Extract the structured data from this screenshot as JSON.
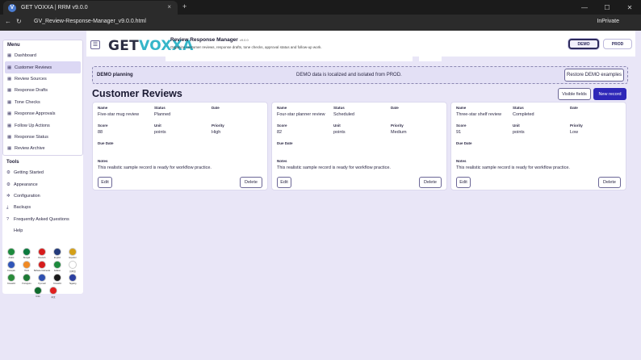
{
  "browser": {
    "tab_title": "GET VOXXA | RRM v9.0.0",
    "url": "GV_Review-Response-Manager_v9.0.0.html",
    "inprivate": "InPrivate",
    "tab_close": "×",
    "new_tab": "+",
    "win_min": "—",
    "win_max": "☐",
    "win_close": "✕",
    "nav_back": "←",
    "nav_refresh": "↻"
  },
  "header": {
    "logo_part1": "GET",
    "logo_part2": "VOXXA",
    "app_title": "Review Response Manager",
    "app_version": "v9.0.0",
    "app_subtitle": "Organize customer reviews, response drafts, tone checks, approval status and follow-up work.",
    "demo_label": "DEMO",
    "prod_label": "PROD",
    "menu_icon": "☰"
  },
  "sidebar": {
    "menu_heading": "Menu",
    "menu_items": [
      {
        "label": "Dashboard",
        "icon": "▦"
      },
      {
        "label": "Customer Reviews",
        "icon": "▦",
        "active": true
      },
      {
        "label": "Review Sources",
        "icon": "▦"
      },
      {
        "label": "Response Drafts",
        "icon": "▦"
      },
      {
        "label": "Tone Checks",
        "icon": "▦"
      },
      {
        "label": "Response Approvals",
        "icon": "▦"
      },
      {
        "label": "Follow Up Actions",
        "icon": "▦"
      },
      {
        "label": "Response Status",
        "icon": "▦"
      },
      {
        "label": "Review Archive",
        "icon": "▦"
      }
    ],
    "tools_heading": "Tools",
    "tools_items": [
      {
        "label": "Getting Started",
        "icon": "⚙"
      },
      {
        "label": "Appearance",
        "icon": "⚙"
      },
      {
        "label": "Configuration",
        "icon": "✲"
      },
      {
        "label": "Backups",
        "icon": "⤓"
      },
      {
        "label": "Frequently Asked Questions",
        "icon": "?"
      },
      {
        "label": "Help",
        "icon": ""
      }
    ],
    "flags": [
      [
        {
          "label": "Arabic",
          "color": "#1d8a3d"
        },
        {
          "label": "Bengali",
          "color": "#0b7a3e"
        },
        {
          "label": "Deutsch",
          "color": "#d61c1c"
        },
        {
          "label": "English",
          "color": "#243b7a"
        },
        {
          "label": "Español",
          "color": "#d4a017"
        }
      ],
      [
        {
          "label": "Français",
          "color": "#3055b8"
        },
        {
          "label": "Hindi",
          "color": "#f08a24"
        },
        {
          "label": "Bahasa Indonesia",
          "color": "#d61c1c"
        },
        {
          "label": "Italiano",
          "color": "#1d8a3d"
        },
        {
          "label": "日本語",
          "color": "#ffffff"
        }
      ],
      [
        {
          "label": "Kiswahili",
          "color": "#2a8b3a"
        },
        {
          "label": "Português",
          "color": "#1d7a34"
        },
        {
          "label": "Русский",
          "color": "#2f50b0"
        },
        {
          "label": "Kiswahili",
          "color": "#1a1a1a"
        },
        {
          "label": "Tagalog",
          "color": "#2b3fa0"
        }
      ],
      [
        {
          "label": "Urdu",
          "color": "#0f6b2d"
        },
        {
          "label": "中文",
          "color": "#e02020"
        }
      ]
    ]
  },
  "banner": {
    "label": "DEMO planning",
    "message": "DEMO data is localized and isolated from PROD.",
    "restore_label": "Restore DEMO examples"
  },
  "section": {
    "title": "Customer Reviews",
    "visible_fields_label": "Visible fields",
    "new_record_label": "New record"
  },
  "field_labels": {
    "name": "Name",
    "status": "Status",
    "date": "Date",
    "score": "Score",
    "unit": "Unit",
    "priority": "Priority",
    "due_date": "Due Date",
    "notes": "Notes"
  },
  "cards": [
    {
      "name": "Five-star mug review",
      "status": "Planned",
      "date": "",
      "score": "88",
      "unit": "points",
      "priority": "High",
      "due_date": "",
      "notes": "This realistic sample record is ready for workflow practice.",
      "edit": "Edit",
      "delete": "Delete"
    },
    {
      "name": "Four-star planner review",
      "status": "Scheduled",
      "date": "",
      "score": "82",
      "unit": "points",
      "priority": "Medium",
      "due_date": "",
      "notes": "This realistic sample record is ready for workflow practice.",
      "edit": "Edit",
      "delete": "Delete"
    },
    {
      "name": "Three-star shelf review",
      "status": "Completed",
      "date": "",
      "score": "91",
      "unit": "points",
      "priority": "Low",
      "due_date": "",
      "notes": "This realistic sample record is ready for workflow practice.",
      "edit": "Edit",
      "delete": "Delete"
    }
  ]
}
